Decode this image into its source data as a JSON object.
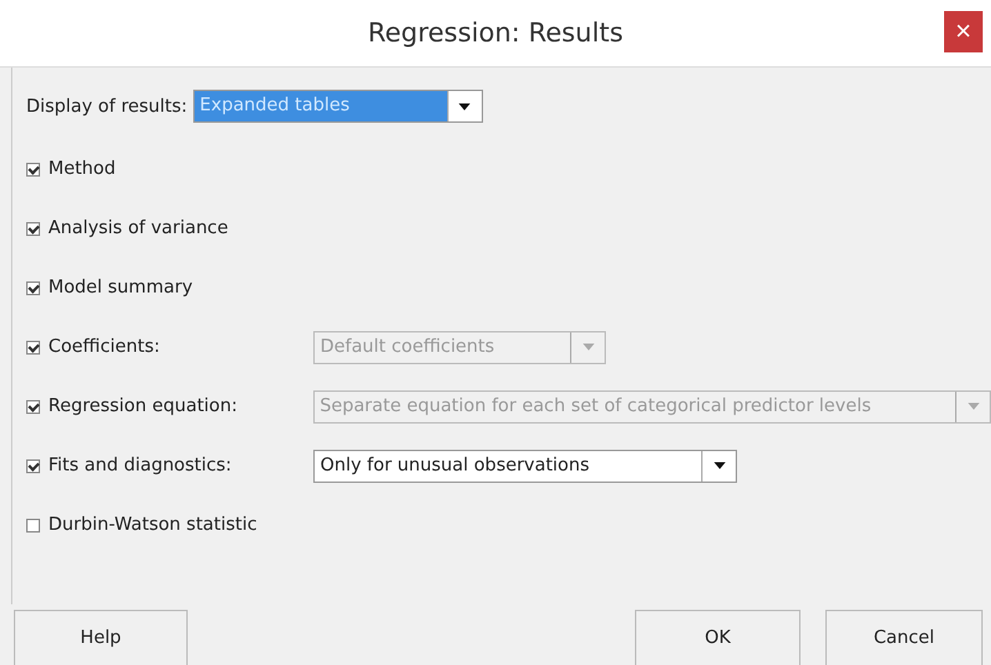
{
  "window": {
    "title": "Regression: Results",
    "close": "×"
  },
  "display": {
    "label": "Display of results:",
    "value": "Expanded tables",
    "focused": true,
    "disabled": false
  },
  "options": [
    {
      "label": "Method",
      "checked": true
    },
    {
      "label": "Analysis of variance",
      "checked": true
    },
    {
      "label": "Model summary",
      "checked": true
    },
    {
      "label": "Coefficients:",
      "checked": true,
      "dropdown": {
        "value": "Default coefficients",
        "disabled": true
      }
    },
    {
      "label": "Regression equation:",
      "checked": true,
      "dropdown": {
        "value": "Separate equation for each set of categorical predictor levels",
        "disabled": true
      }
    },
    {
      "label": "Fits and diagnostics:",
      "checked": true,
      "dropdown": {
        "value": "Only for unusual observations",
        "disabled": false
      }
    },
    {
      "label": "Durbin-Watson statistic",
      "checked": false
    }
  ],
  "buttons": [
    {
      "label": "Help"
    },
    {
      "label": "OK"
    },
    {
      "label": "Cancel"
    }
  ]
}
